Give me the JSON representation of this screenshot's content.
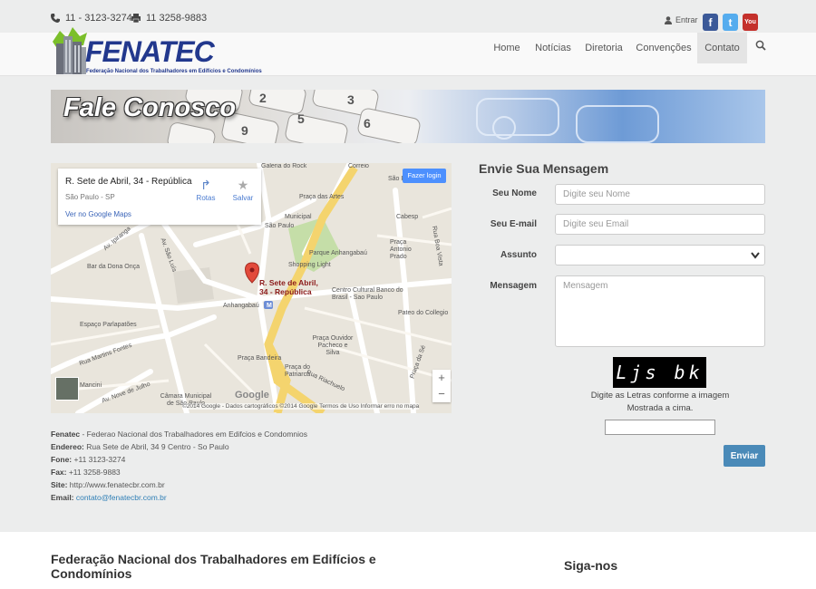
{
  "topbar": {
    "phone1": "11 - 3123-3274",
    "phone2": "11 3258-9883",
    "login": "Entrar",
    "social": [
      {
        "name": "facebook",
        "glyph": "f",
        "color": "#3b5998"
      },
      {
        "name": "twitter",
        "glyph": "t",
        "color": "#55acee"
      },
      {
        "name": "youtube",
        "glyph": "You",
        "color": "#c4302b"
      }
    ]
  },
  "logo": {
    "title": "FENATEC",
    "subtitle": "Federação Nacional dos Trabalhadores em Edifícios e Condomínios"
  },
  "nav": {
    "items": [
      {
        "label": "Home"
      },
      {
        "label": "Notícias"
      },
      {
        "label": "Diretoria"
      },
      {
        "label": "Convenções"
      },
      {
        "label": "Contato",
        "active": true
      }
    ]
  },
  "banner": {
    "title": "Fale Conosco"
  },
  "map": {
    "card": {
      "address": "R. Sete de Abril, 34 - República",
      "city": "São Paulo - SP",
      "link": "Ver no Google Maps",
      "routes": "Rotas",
      "save": "Salvar"
    },
    "login_button": "Fazer login",
    "pin_label_1": "R. Sete de Abril,",
    "pin_label_2": "34 - República",
    "labels": {
      "galeria": "Galeria do Rock",
      "correio": "Correio",
      "praca_artes": "Praça das Artes",
      "sao_bento": "São Bento",
      "municipal": "Municipal",
      "sao_paulo": "São Paulo",
      "cabesp": "Cabesp",
      "parque": "Parque Anhangabaú",
      "praca_prado": "Praça Antonio Prado",
      "boa_vista": "Rua Boa Vista",
      "shopping": "Shopping Light",
      "dona_onca": "Bar da Dona Onça",
      "centro": "Centro Cultural Banco do Brasil - Sao Paulo",
      "anhangabau": "Anhangabaú",
      "pateo": "Pateo do Collegio",
      "parlapatoes": "Espaço Parlapatões",
      "praca_ouvidor": "Praça Ouvidor Pacheco e Silva",
      "bandeira": "Praça Bandeira",
      "praca_se": "Praça da Sé",
      "praca_patriarca": "Praça do Patriarca",
      "martins": "Rua Martins Fontes",
      "mancini": "Mancini",
      "julho": "Av. Nove de Julho",
      "camara": "Câmara Municipal de São Paulo",
      "ipiranga": "Av. Ipiranga",
      "sao_luis": "Av. São Luís",
      "riachuelo": "Rua Riachuelo"
    },
    "google": "Google",
    "footer": "©2014 Google - Dados cartográficos ©2014 Google     Termos de Uso     Informar erro no mapa",
    "zoom_in": "+",
    "zoom_out": "−"
  },
  "info": {
    "line1_b": "Fenatec",
    "line1": " - Federao Nacional dos Trabalhadores em Edifcios e Condomnios",
    "line2_b": "Endereo:",
    "line2": " Rua Sete de Abril, 34 9 Centro - So Paulo",
    "line3_b": "Fone:",
    "line3": " +11 3123-3274",
    "line4_b": "Fax:",
    "line4": " +11 3258-9883",
    "line5_b": "Site:",
    "line5": " http://www.fenatecbr.com.br",
    "line6_b": "Email:",
    "line6": "contato@fenatecbr.com.br"
  },
  "form": {
    "title": "Envie Sua Mensagem",
    "name_label": "Seu Nome",
    "name_placeholder": "Digite seu Nome",
    "email_label": "Seu E-mail",
    "email_placeholder": "Digite seu Email",
    "subject_label": "Assunto",
    "subject_value": "",
    "message_label": "Mensagem",
    "message_placeholder": "Mensagem",
    "captcha": "Ljs bk",
    "captcha_text_1": "Digite as Letras conforme a imagem",
    "captcha_text_2": "Mostrada a cima.",
    "send": "Enviar"
  },
  "footer": {
    "heading1": "Federação Nacional dos Trabalhadores em Edifícios e Condomínios",
    "heading2": "Siga-nos"
  }
}
